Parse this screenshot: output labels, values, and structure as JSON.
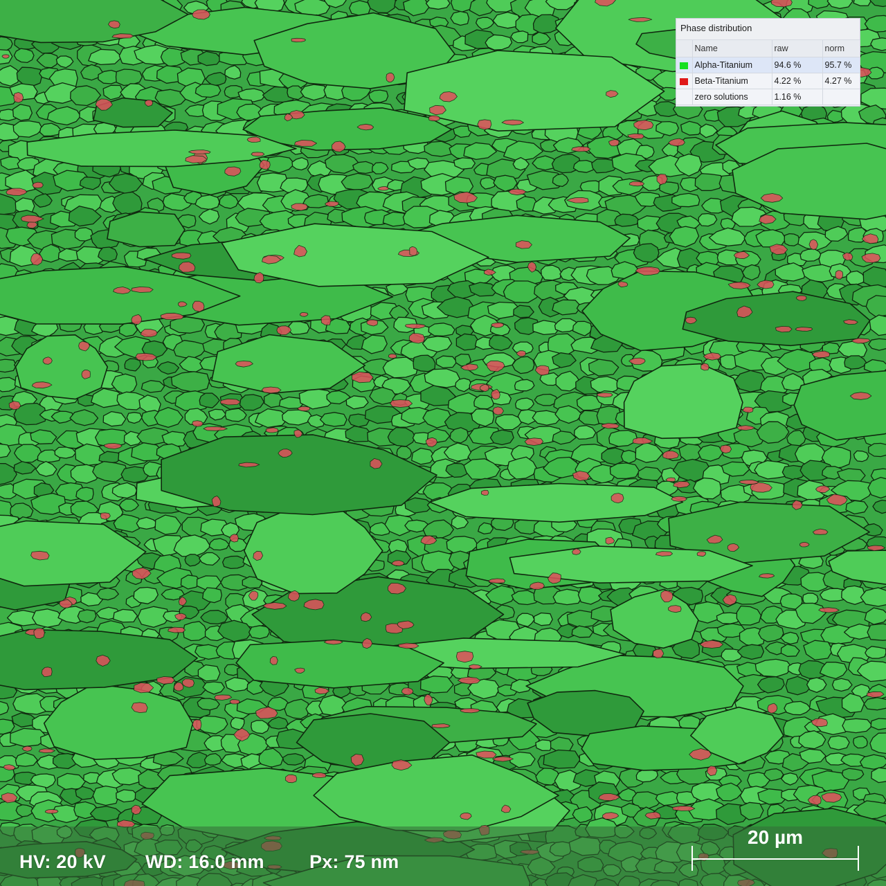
{
  "image": {
    "subject": "EBSD phase map of titanium alloy microstructure",
    "colors": {
      "alpha_phase": "#3fbb4a",
      "alpha_phase_light": "#55d25e",
      "alpha_phase_dark": "#2f9a3a",
      "beta_phase": "#e0505c",
      "grain_boundary": "#10280f"
    }
  },
  "phase_panel": {
    "title": "Phase distribution",
    "columns": [
      "Name",
      "raw",
      "norm"
    ],
    "rows": [
      {
        "swatch_color": "#16e020",
        "name": "Alpha-Titanium",
        "raw": "94.6 %",
        "norm": "95.7 %"
      },
      {
        "swatch_color": "#e01a1a",
        "name": "Beta-Titanium",
        "raw": "4.22 %",
        "norm": "4.27 %"
      },
      {
        "swatch_color": "",
        "name": "zero solutions",
        "raw": "1.16 %",
        "norm": ""
      }
    ]
  },
  "databar": {
    "hv": "HV: 20 kV",
    "wd": "WD: 16.0 mm",
    "px": "Px: 75 nm",
    "scale_label": "20 µm"
  }
}
